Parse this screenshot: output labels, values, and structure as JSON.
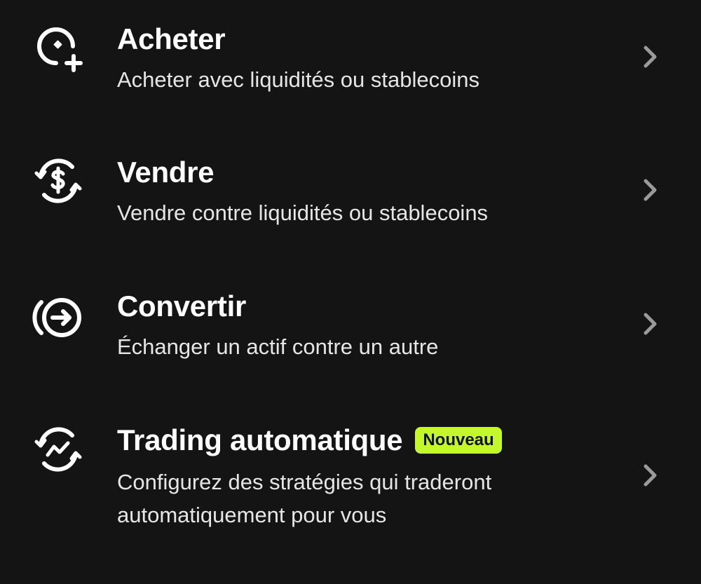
{
  "colors": {
    "background": "#141414",
    "text": "#ffffff",
    "subtitle": "#e6e6e6",
    "badge_background": "#c4f82a",
    "badge_text": "#111111",
    "chevron": "#9a9a9a"
  },
  "items": [
    {
      "icon": "buy-coin-plus-icon",
      "title": "Acheter",
      "subtitle": "Acheter avec liquidités ou stablecoins"
    },
    {
      "icon": "sell-dollar-cycle-icon",
      "title": "Vendre",
      "subtitle": "Vendre contre liquidités ou stablecoins"
    },
    {
      "icon": "convert-arrow-circle-icon",
      "title": "Convertir",
      "subtitle": "Échanger un actif contre un autre"
    },
    {
      "icon": "auto-trading-cycle-icon",
      "title": "Trading automatique",
      "badge": "Nouveau",
      "subtitle": "Configurez des stratégies qui traderont automatiquement pour vous"
    }
  ]
}
